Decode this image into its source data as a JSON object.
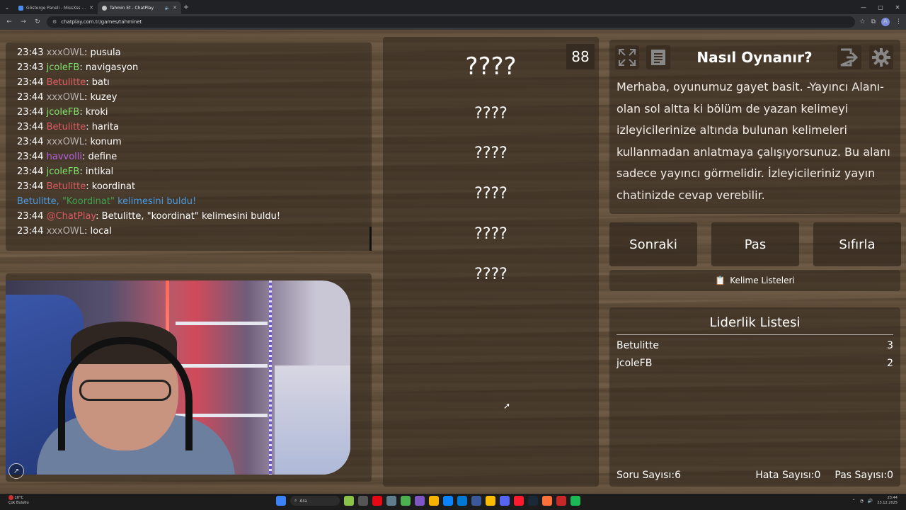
{
  "browser": {
    "tabs": [
      {
        "title": "Gösterge Paneli - MissXss AI B...",
        "active": false
      },
      {
        "title": "Tahmin Et - ChatPlay",
        "active": true
      }
    ],
    "url": "chatplay.com.tr/games/tahminet",
    "profile_initial": "A"
  },
  "chat": {
    "lines": [
      {
        "time": "23:43",
        "user": "xxxOWL",
        "color": "#b8b2ae",
        "msg": ": pusula"
      },
      {
        "time": "23:43",
        "user": "jcoleFB",
        "color": "#7ee36b",
        "msg": ": navigasyon"
      },
      {
        "time": "23:44",
        "user": "Betulitte",
        "color": "#e05a64",
        "msg": ": batı"
      },
      {
        "time": "23:44",
        "user": "xxxOWL",
        "color": "#b8b2ae",
        "msg": ": kuzey"
      },
      {
        "time": "23:44",
        "user": "jcoleFB",
        "color": "#7ee36b",
        "msg": ": kroki"
      },
      {
        "time": "23:44",
        "user": "Betulitte",
        "color": "#e05a64",
        "msg": ": harita"
      },
      {
        "time": "23:44",
        "user": "xxxOWL",
        "color": "#b8b2ae",
        "msg": ": konum"
      },
      {
        "time": "23:44",
        "user": "havvolli",
        "color": "#b560e0",
        "msg": ": define"
      },
      {
        "time": "23:44",
        "user": "jcoleFB",
        "color": "#7ee36b",
        "msg": ": intikal"
      },
      {
        "time": "23:44",
        "user": "Betulitte",
        "color": "#e05a64",
        "msg": ": koordinat"
      }
    ],
    "notice": {
      "pre": "Betulitte, ",
      "hl": "\"Koordinat\"",
      "post": " kelimesini buldu!"
    },
    "bot_line": {
      "time": "23:44",
      "user": "@ChatPlay",
      "color": "#e05a64",
      "msg": ": Betulitte, \"koordinat\" kelimesini buldu!"
    },
    "last_line": {
      "time": "23:44",
      "user": "xxxOWL",
      "color": "#b8b2ae",
      "msg": ": local"
    }
  },
  "game": {
    "timer": "88",
    "main_word": "????",
    "forbidden_words": [
      "????",
      "????",
      "????",
      "????",
      "????"
    ]
  },
  "howto": {
    "title": "Nasıl Oynanır?",
    "body": "Merhaba, oyunumuz gayet basit. -Yayıncı Alanı- olan sol altta ki bölüm de yazan kelimeyi izleyicilerinize altında bulunan kelimeleri kullanmadan anlatmaya çalışıyorsunuz. Bu alanı sadece yayıncı görmelidir. İzleyicileriniz yayın chatinizde cevap verebilir."
  },
  "controls": {
    "next": "Sonraki",
    "pass": "Pas",
    "reset": "Sıfırla"
  },
  "word_lists": {
    "icon": "📋",
    "label": "Kelime Listeleri"
  },
  "leaderboard": {
    "title": "Liderlik Listesi",
    "rows": [
      {
        "name": "Betulitte",
        "score": "3"
      },
      {
        "name": "jcoleFB",
        "score": "2"
      }
    ],
    "stats": {
      "questions": "Soru Sayısı:6",
      "errors": "Hata Sayısı:0",
      "passes": "Pas Sayısı:0"
    }
  },
  "taskbar": {
    "weather_temp": "10°C",
    "weather_desc": "Çok Bulutlu",
    "search_placeholder": "Ara",
    "time": "23:44",
    "date": "23.12.2025"
  }
}
